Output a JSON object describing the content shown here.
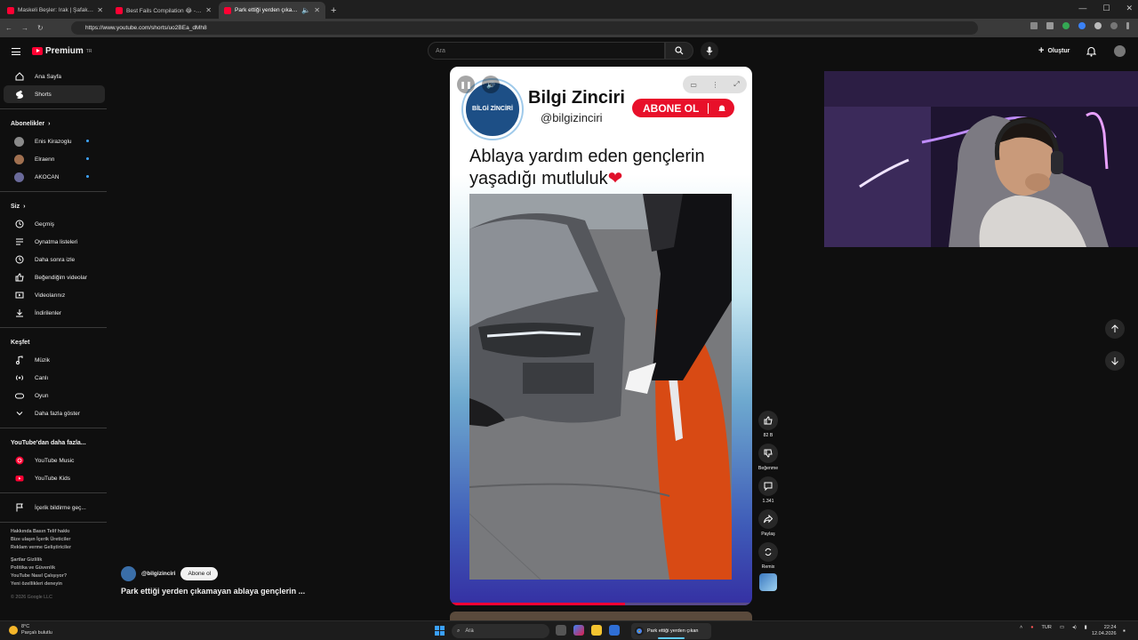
{
  "browser": {
    "tabs": [
      {
        "title": "Maskeli Beşler: Irak | Şafak Sezer..."
      },
      {
        "title": "Best Fails Compilation 😂 - YouTube"
      },
      {
        "title": "Park ettiği yerden çıkamayan..."
      }
    ],
    "url": "https://www.youtube.com/shorts/uo2BEa_dMh8"
  },
  "header": {
    "logo_label": "Premium",
    "logo_sup": "TR",
    "search_placeholder": "Ara",
    "create_label": "Oluştur"
  },
  "sidebar": {
    "main": [
      {
        "label": "Ana Sayfa",
        "icon": "home-icon"
      },
      {
        "label": "Shorts",
        "icon": "shorts-icon",
        "active": true
      }
    ],
    "subscriptions_title": "Abonelikler",
    "subscriptions": [
      {
        "label": "Enis Kirazoglu"
      },
      {
        "label": "Elraenn"
      },
      {
        "label": "AKOCAN"
      }
    ],
    "you_title": "Siz",
    "you": [
      {
        "label": "Geçmiş",
        "icon": "history-icon"
      },
      {
        "label": "Oynatma listeleri",
        "icon": "playlist-icon"
      },
      {
        "label": "Daha sonra izle",
        "icon": "clock-icon"
      },
      {
        "label": "Beğendiğim videolar",
        "icon": "thumbs-up-icon"
      },
      {
        "label": "Videolarınız",
        "icon": "video-icon"
      },
      {
        "label": "İndirilenler",
        "icon": "download-icon"
      }
    ],
    "explore_title": "Keşfet",
    "explore": [
      {
        "label": "Müzik",
        "icon": "music-icon"
      },
      {
        "label": "Canlı",
        "icon": "live-icon"
      },
      {
        "label": "Oyun",
        "icon": "gamepad-icon"
      },
      {
        "label": "Daha fazla göster",
        "icon": "chevron-down-icon"
      }
    ],
    "more_title": "YouTube'dan daha fazla...",
    "more": [
      {
        "label": "YouTube Music"
      },
      {
        "label": "YouTube Kids"
      }
    ],
    "report_label": "İçerik bildirme geç...",
    "footer_line1": "Hakkında  Basın  Telif hakkı",
    "footer_line2": "Bize ulaşın  İçerik Üreticiler",
    "footer_line3": "Reklam verme  Geliştiriciler",
    "footer_line4": "Şartlar  Gizlilik",
    "footer_line5": "Politika ve Güvenlik",
    "footer_line6": "YouTube Nasıl Çalışıyor?",
    "footer_line7": "Yeni özellikleri deneyin",
    "copyright": "© 2026 Google LLC"
  },
  "short": {
    "channel_display": "Bilgi Zinciri",
    "handle_display": "@bilgizinciri",
    "logo_text": "BİLGİ ZİNCİRİ",
    "subscribe_overlay": "ABONE OL",
    "headline": "Ablaya yardım eden gençlerin yaşadığı mutluluk",
    "heart": "❤",
    "progress": 0.58
  },
  "actions": {
    "likes": "82 B",
    "dislike_label": "Beğenme",
    "comments": "1.341",
    "share_label": "Paylaş",
    "remix_label": "Remix"
  },
  "meta": {
    "channel": "@bilgizinciri",
    "subscribe_label": "Abone ol",
    "title": "Park ettiği yerden çıkamayan ablaya gençlerin ..."
  },
  "taskbar": {
    "temp": "8°C",
    "weather": "Parçalı bulutlu",
    "search": "Ara",
    "active_app": "Park ettiği yerden çıkan",
    "lang": "TUR",
    "time": "22:24",
    "date": "12.04.2026"
  }
}
